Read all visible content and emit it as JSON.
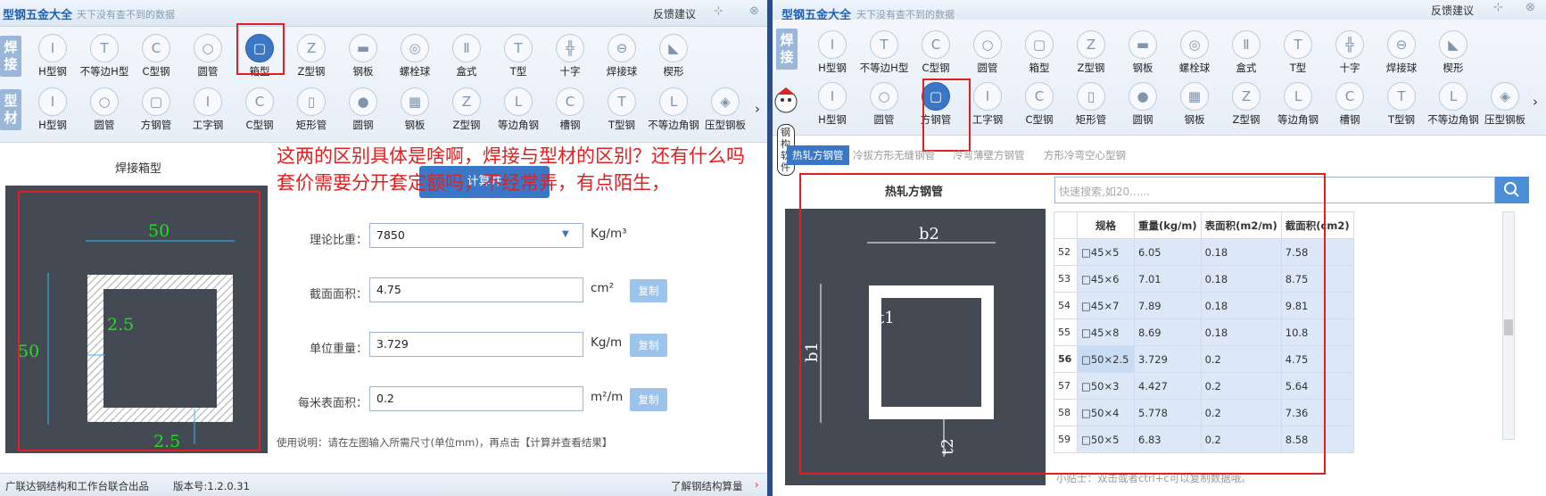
{
  "left": {
    "title": "型钢五金大全",
    "subtitle": "天下没有查不到的数据",
    "feedback": "反馈建议",
    "pin": "⊹",
    "close": "⊗",
    "groups": [
      {
        "label": "焊接",
        "items": [
          {
            "icon": "H-beam-icon",
            "glyph": "I",
            "label": "H型钢"
          },
          {
            "icon": "unequal-H-beam-icon",
            "glyph": "T",
            "label": "不等边H型"
          },
          {
            "icon": "C-beam-icon",
            "glyph": "C",
            "label": "C型钢"
          },
          {
            "icon": "round-pipe-icon",
            "glyph": "○",
            "label": "圆管"
          },
          {
            "icon": "box-section-icon",
            "glyph": "▢",
            "label": "箱型",
            "active": true
          },
          {
            "icon": "Z-beam-icon",
            "glyph": "Z",
            "label": "Z型钢"
          },
          {
            "icon": "steel-plate-icon",
            "glyph": "▬",
            "label": "钢板"
          },
          {
            "icon": "bolt-ball-icon",
            "glyph": "◎",
            "label": "螺栓球"
          },
          {
            "icon": "box-type-icon",
            "glyph": "Ⅱ",
            "label": "盒式"
          },
          {
            "icon": "T-beam-icon",
            "glyph": "T",
            "label": "T型"
          },
          {
            "icon": "cross-beam-icon",
            "glyph": "╬",
            "label": "十字"
          },
          {
            "icon": "welded-ball-icon",
            "glyph": "⊖",
            "label": "焊接球"
          },
          {
            "icon": "wedge-icon",
            "glyph": "◣",
            "label": "楔形"
          }
        ]
      },
      {
        "label": "型材",
        "items": [
          {
            "icon": "H-beam-icon",
            "glyph": "I",
            "label": "H型钢"
          },
          {
            "icon": "round-pipe-icon",
            "glyph": "○",
            "label": "圆管"
          },
          {
            "icon": "square-pipe-icon",
            "glyph": "▢",
            "label": "方钢管"
          },
          {
            "icon": "I-beam-icon",
            "glyph": "I",
            "label": "工字钢"
          },
          {
            "icon": "C-beam-icon",
            "glyph": "C",
            "label": "C型钢"
          },
          {
            "icon": "rect-pipe-icon",
            "glyph": "▯",
            "label": "矩形管"
          },
          {
            "icon": "round-steel-icon",
            "glyph": "●",
            "label": "圆钢"
          },
          {
            "icon": "steel-plate-icon",
            "glyph": "▦",
            "label": "钢板"
          },
          {
            "icon": "Z-beam-icon",
            "glyph": "Z",
            "label": "Z型钢"
          },
          {
            "icon": "equal-angle-icon",
            "glyph": "L",
            "label": "等边角钢"
          },
          {
            "icon": "channel-icon",
            "glyph": "C",
            "label": "槽钢"
          },
          {
            "icon": "T-beam-icon",
            "glyph": "T",
            "label": "T型钢"
          },
          {
            "icon": "unequal-angle-icon",
            "glyph": "L",
            "label": "不等边角钢"
          },
          {
            "icon": "deck-plate-icon",
            "glyph": "◈",
            "label": "压型钢板"
          }
        ]
      }
    ],
    "section_title": "焊接箱型",
    "dims": {
      "top": "50",
      "left": "50",
      "t1": "2.5",
      "t2": "2.5"
    },
    "annotation": "这两的区别具体是啥啊，焊接与型材的区别？还有什么吗套价需要分开套定额吗，不经常弄，有点陌生，",
    "calc_button": "计算并",
    "fields": [
      {
        "label": "理论比重：",
        "value": "7850",
        "unit": "Kg/m³",
        "dropdown": true
      },
      {
        "label": "截面面积：",
        "value": "4.75",
        "unit": "cm²",
        "copy": "复制"
      },
      {
        "label": "单位重量：",
        "value": "3.729",
        "unit": "Kg/m",
        "copy": "复制"
      },
      {
        "label": "每米表面积：",
        "value": "0.2",
        "unit": "m²/m",
        "copy": "复制"
      }
    ],
    "usage": "使用说明：请在左图输入所需尺寸(单位mm)，再点击【计算并查看结果】",
    "status_left": "广联达钢结构和工作台联合出品",
    "version": "版本号:1.2.0.31",
    "status_right": "了解钢结构算量"
  },
  "right": {
    "title": "型钢五金大全",
    "subtitle": "天下没有查不到的数据",
    "feedback": "反馈建议",
    "groups": [
      {
        "label": "焊接",
        "items": [
          {
            "icon": "H-beam-icon",
            "glyph": "I",
            "label": "H型钢"
          },
          {
            "icon": "unequal-H-beam-icon",
            "glyph": "T",
            "label": "不等边H型"
          },
          {
            "icon": "C-beam-icon",
            "glyph": "C",
            "label": "C型钢"
          },
          {
            "icon": "round-pipe-icon",
            "glyph": "○",
            "label": "圆管"
          },
          {
            "icon": "box-section-icon",
            "glyph": "▢",
            "label": "箱型"
          },
          {
            "icon": "Z-beam-icon",
            "glyph": "Z",
            "label": "Z型钢"
          },
          {
            "icon": "steel-plate-icon",
            "glyph": "▬",
            "label": "钢板"
          },
          {
            "icon": "bolt-ball-icon",
            "glyph": "◎",
            "label": "螺栓球"
          },
          {
            "icon": "box-type-icon",
            "glyph": "Ⅱ",
            "label": "盒式"
          },
          {
            "icon": "T-beam-icon",
            "glyph": "T",
            "label": "T型"
          },
          {
            "icon": "cross-beam-icon",
            "glyph": "╬",
            "label": "十字"
          },
          {
            "icon": "welded-ball-icon",
            "glyph": "⊖",
            "label": "焊接球"
          },
          {
            "icon": "wedge-icon",
            "glyph": "◣",
            "label": "楔形"
          }
        ]
      },
      {
        "label": "型材",
        "items": [
          {
            "icon": "H-beam-icon",
            "glyph": "I",
            "label": "H型钢"
          },
          {
            "icon": "round-pipe-icon",
            "glyph": "○",
            "label": "圆管"
          },
          {
            "icon": "square-pipe-icon",
            "glyph": "▢",
            "label": "方钢管",
            "active": true
          },
          {
            "icon": "I-beam-icon",
            "glyph": "I",
            "label": "工字钢"
          },
          {
            "icon": "C-beam-icon",
            "glyph": "C",
            "label": "C型钢"
          },
          {
            "icon": "rect-pipe-icon",
            "glyph": "▯",
            "label": "矩形管"
          },
          {
            "icon": "round-steel-icon",
            "glyph": "●",
            "label": "圆钢"
          },
          {
            "icon": "steel-plate-icon",
            "glyph": "▦",
            "label": "钢板"
          },
          {
            "icon": "Z-beam-icon",
            "glyph": "Z",
            "label": "Z型钢"
          },
          {
            "icon": "equal-angle-icon",
            "glyph": "L",
            "label": "等边角钢"
          },
          {
            "icon": "channel-icon",
            "glyph": "C",
            "label": "槽钢"
          },
          {
            "icon": "T-beam-icon",
            "glyph": "T",
            "label": "T型钢"
          },
          {
            "icon": "unequal-angle-icon",
            "glyph": "L",
            "label": "不等边角钢"
          },
          {
            "icon": "deck-plate-icon",
            "glyph": "◈",
            "label": "压型钢板"
          }
        ]
      }
    ],
    "mascot_text": "钢构软件",
    "tabs": [
      "热轧方钢管",
      "冷拔方形无缝钢管",
      "冷弯薄壁方钢管",
      "方形冷弯空心型钢"
    ],
    "section_title": "热轧方钢管",
    "search_placeholder": "快速搜索,如20......",
    "dims": {
      "b2": "b2",
      "b1": "b1",
      "t1": "t1",
      "t2": "t2"
    },
    "table_headers": [
      "规格",
      "重量(kg/m)",
      "表面积(m2/m)",
      "截面积(cm2)"
    ],
    "rows": [
      {
        "n": "52",
        "spec": "□45×5",
        "w": "6.05",
        "s": "0.18",
        "a": "7.58"
      },
      {
        "n": "53",
        "spec": "□45×6",
        "w": "7.01",
        "s": "0.18",
        "a": "8.75"
      },
      {
        "n": "54",
        "spec": "□45×7",
        "w": "7.89",
        "s": "0.18",
        "a": "9.81"
      },
      {
        "n": "55",
        "spec": "□45×8",
        "w": "8.69",
        "s": "0.18",
        "a": "10.8"
      },
      {
        "n": "56",
        "spec": "□50×2.5",
        "w": "3.729",
        "s": "0.2",
        "a": "4.75",
        "selected": true
      },
      {
        "n": "57",
        "spec": "□50×3",
        "w": "4.427",
        "s": "0.2",
        "a": "5.64"
      },
      {
        "n": "58",
        "spec": "□50×4",
        "w": "5.778",
        "s": "0.2",
        "a": "7.36"
      },
      {
        "n": "59",
        "spec": "□50×5",
        "w": "6.83",
        "s": "0.2",
        "a": "8.58"
      }
    ],
    "tip": "小贴士：双击或者ctrl+c可以复制数据哦。"
  },
  "colors": {
    "accent": "#3a78c7",
    "annotation_red": "#e02020",
    "drawing_bg": "#444a54",
    "row_highlight": "#dce8f7",
    "dim_green": "#22dd22"
  }
}
